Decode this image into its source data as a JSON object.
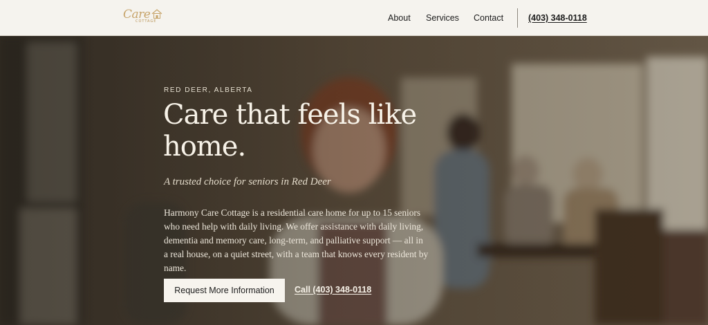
{
  "header": {
    "logo": {
      "script_text": "Care",
      "small_text": "COTTAGE",
      "icon": "house-icon"
    },
    "nav": [
      {
        "label": "About"
      },
      {
        "label": "Services"
      },
      {
        "label": "Contact"
      }
    ],
    "phone": "(403) 348-0118"
  },
  "hero": {
    "eyebrow": "RED DEER, ALBERTA",
    "headline": "Care that feels like home.",
    "tagline": "A trusted choice for seniors in Red Deer",
    "body": "Harmony Care Cottage is a residential care home for up to 15 seniors who need help with daily living. We offer assistance with daily living, dementia and memory care, long-term, and palliative support — all in a real house, on a quiet street, with a team that knows every resident by name.",
    "cta_primary": "Request More Information",
    "cta_secondary": "Call (403) 348-0118"
  },
  "colors": {
    "header_bg": "#f5f3ee",
    "logo_gold": "#c7a46a",
    "hero_text": "#f7f2e8",
    "button_bg": "#f7f4ee"
  }
}
